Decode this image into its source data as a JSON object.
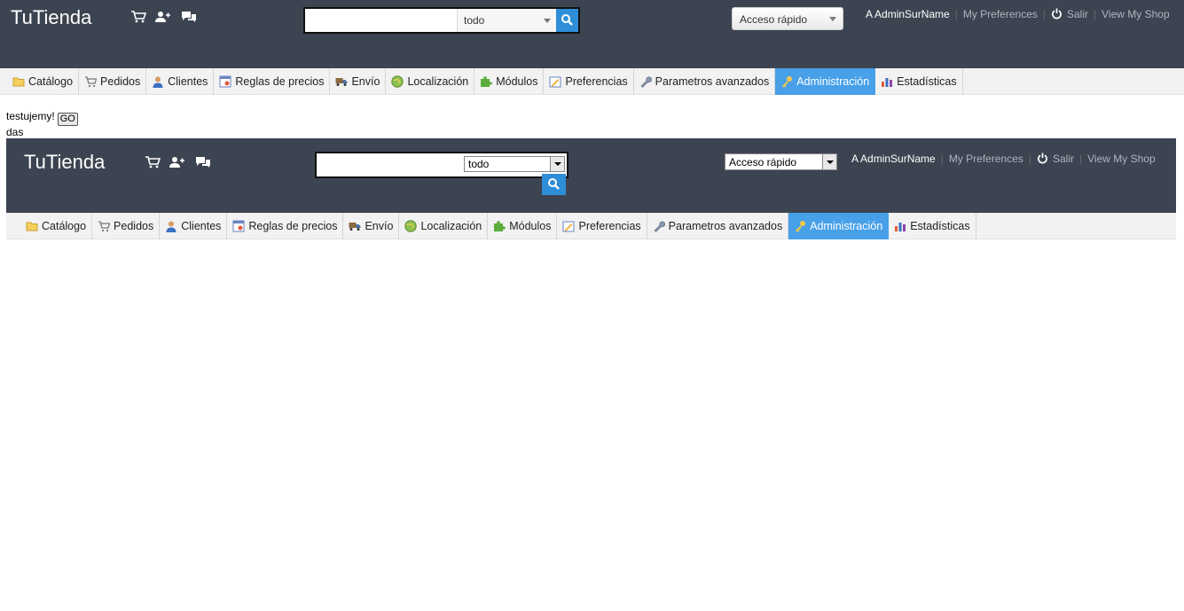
{
  "header": {
    "brand": "TuTienda",
    "search": {
      "value": "",
      "scope": "todo"
    },
    "quick_access": "Acceso rápido",
    "user_name": "A AdminSurName",
    "links": {
      "preferences": "My Preferences",
      "logout": "Salir",
      "view_shop": "View My Shop"
    },
    "icons": [
      "cart-icon",
      "customers-icon",
      "messages-icon",
      "search-icon",
      "power-icon"
    ]
  },
  "tabs": [
    {
      "label": "Catálogo",
      "icon": "folder-icon"
    },
    {
      "label": "Pedidos",
      "icon": "cart-icon"
    },
    {
      "label": "Clientes",
      "icon": "user-icon"
    },
    {
      "label": "Reglas de precios",
      "icon": "price-rules-icon"
    },
    {
      "label": "Envío",
      "icon": "truck-icon"
    },
    {
      "label": "Localización",
      "icon": "globe-icon"
    },
    {
      "label": "Módulos",
      "icon": "puzzle-icon"
    },
    {
      "label": "Preferencias",
      "icon": "preferences-icon"
    },
    {
      "label": "Parametros avanzados",
      "icon": "wrench-icon"
    },
    {
      "label": "Administración",
      "icon": "key-icon",
      "active": true
    },
    {
      "label": "Estadísticas",
      "icon": "chart-icon"
    }
  ],
  "content": {
    "line1": "testujemy!",
    "go_button": "GO",
    "line2": "das"
  },
  "colors": {
    "header_bg": "#3d4451",
    "active_tab": "#47a0e8",
    "search_button": "#2e8ed8"
  }
}
